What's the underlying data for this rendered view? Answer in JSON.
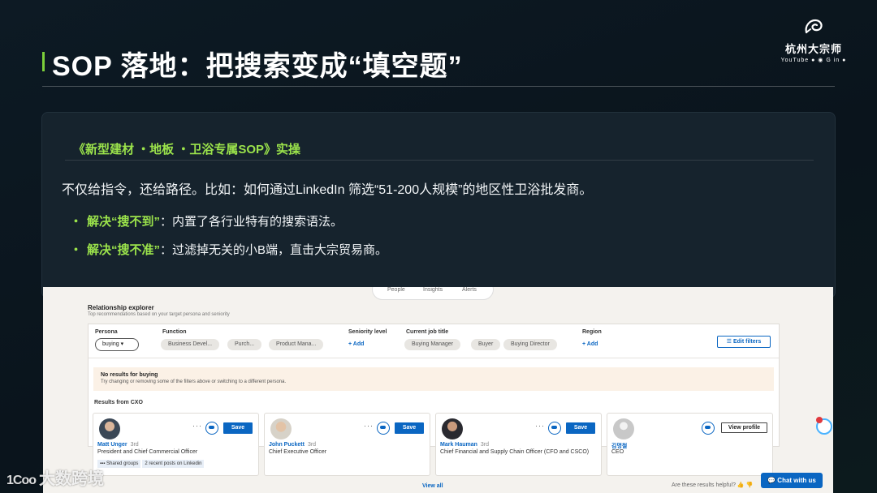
{
  "slide": {
    "title": "SOP  落地：把搜索变成“填空题”",
    "logo_text": "杭州大宗师",
    "logo_social": "YouTube ● ◉ G in ●",
    "accent_color": "#9be34b"
  },
  "panel": {
    "heading": "《新型建材 ・地板 ・卫浴专属SOP》实操",
    "text": "不仅给指令，还给路径。比如：如何通过LinkedIn  筛选“51-200人规模”的地区性卫浴批发商。",
    "bullets": [
      {
        "dot": "・",
        "highlight": "解决“搜不到”",
        "rest": "：内置了各行业特有的搜索语法。"
      },
      {
        "dot": "・",
        "highlight": "解决“搜不准”",
        "rest": "：过滤掉无关的小B端，直击大宗贸易商。"
      }
    ]
  },
  "linkedin": {
    "tabs": [
      "People",
      "Insights",
      "Alerts"
    ],
    "title": "Relationship explorer",
    "subtitle": "Top recommendations based on your target persona and seniority",
    "filters": {
      "persona_label": "Persona",
      "persona_value": "buying ▾",
      "function_label": "Function",
      "function_pills": [
        "Business Devel...",
        "Purch...",
        "Product Mana..."
      ],
      "seniority_label": "Seniority level",
      "add_label": "+ Add",
      "job_title_label": "Current job title",
      "job_pills": [
        "Buying Manager",
        "Buyer",
        "Buying Director"
      ],
      "region_label": "Region",
      "edit_label": "☰ Edit filters"
    },
    "no_results_title": "No results for buying",
    "no_results_sub": "Try changing or removing some of the filters above or switching to a different persona.",
    "results_label": "Results from CXO",
    "cards": [
      {
        "name": "Matt Unger",
        "degree": "3rd",
        "role": "President and Chief Commercial Officer",
        "tag1": "▪▪▪ Shared groups",
        "tag2": "2 recent posts on Linkedin",
        "button": "Save",
        "dots": "···"
      },
      {
        "name": "John Puckett",
        "degree": "3rd",
        "role": "Chief Executive Officer",
        "button": "Save",
        "dots": "···"
      },
      {
        "name": "Mark Hauman",
        "degree": "3rd",
        "role": "Chief Financial and Supply Chain Officer (CFO and CSCO)",
        "button": "Save",
        "dots": "···"
      },
      {
        "name": "김명철",
        "role": "CEO",
        "button": "View profile"
      }
    ],
    "view_all": "View all",
    "helpful": "Are these results helpful?  👍  👎",
    "chat": "💬 Chat with us"
  },
  "watermark": {
    "glyph": "1Coo",
    "text": "大数跨境"
  }
}
